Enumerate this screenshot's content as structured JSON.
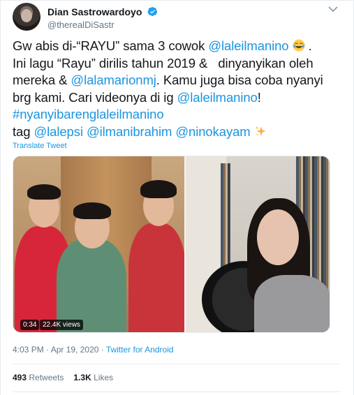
{
  "tweet": {
    "author": {
      "display_name": "Dian Sastrowardoyo",
      "handle": "@therealDiSastr",
      "verified": true
    },
    "text": {
      "l1_a": "Gw abis di-“RAYU” sama 3 cowok ",
      "l1_mention": "@laleilmanino",
      "l1_emoji": "face-with-tears-of-joy-emoji",
      "l1_b": " .",
      "l2": "Ini lagu “Rayu” dirilis tahun 2019 &   dinyanyikan oleh",
      "l3_a": "mereka & ",
      "l3_mention": "@lalamarionmj",
      "l3_b": ". Kamu juga bisa coba nyanyi",
      "l4_a": "brg kami. Cari videonya di ig ",
      "l4_mention": "@laleilmanino",
      "l4_b": "!",
      "l5_hashtag": "#nyanyibarenglaleilmanino",
      "l6_a": "tag ",
      "l6_mention1": "@lalepsi",
      "l6_mention2": "@ilmanibrahim",
      "l6_mention3": "@ninokayam",
      "l6_emoji": "sparkles-emoji"
    },
    "translate_label": "Translate Tweet",
    "video": {
      "duration": "0:34",
      "views": "22.4K views"
    },
    "timestamp": "4:03 PM · Apr 19, 2020 · ",
    "source": "Twitter for Android",
    "stats": {
      "retweets_count": "493",
      "retweets_label": "Retweets",
      "likes_count": "1.3K",
      "likes_label": "Likes"
    }
  },
  "colors": {
    "link": "#1b95e0",
    "text": "#14171a",
    "secondary": "#657786",
    "verified": "#1da1f2"
  }
}
